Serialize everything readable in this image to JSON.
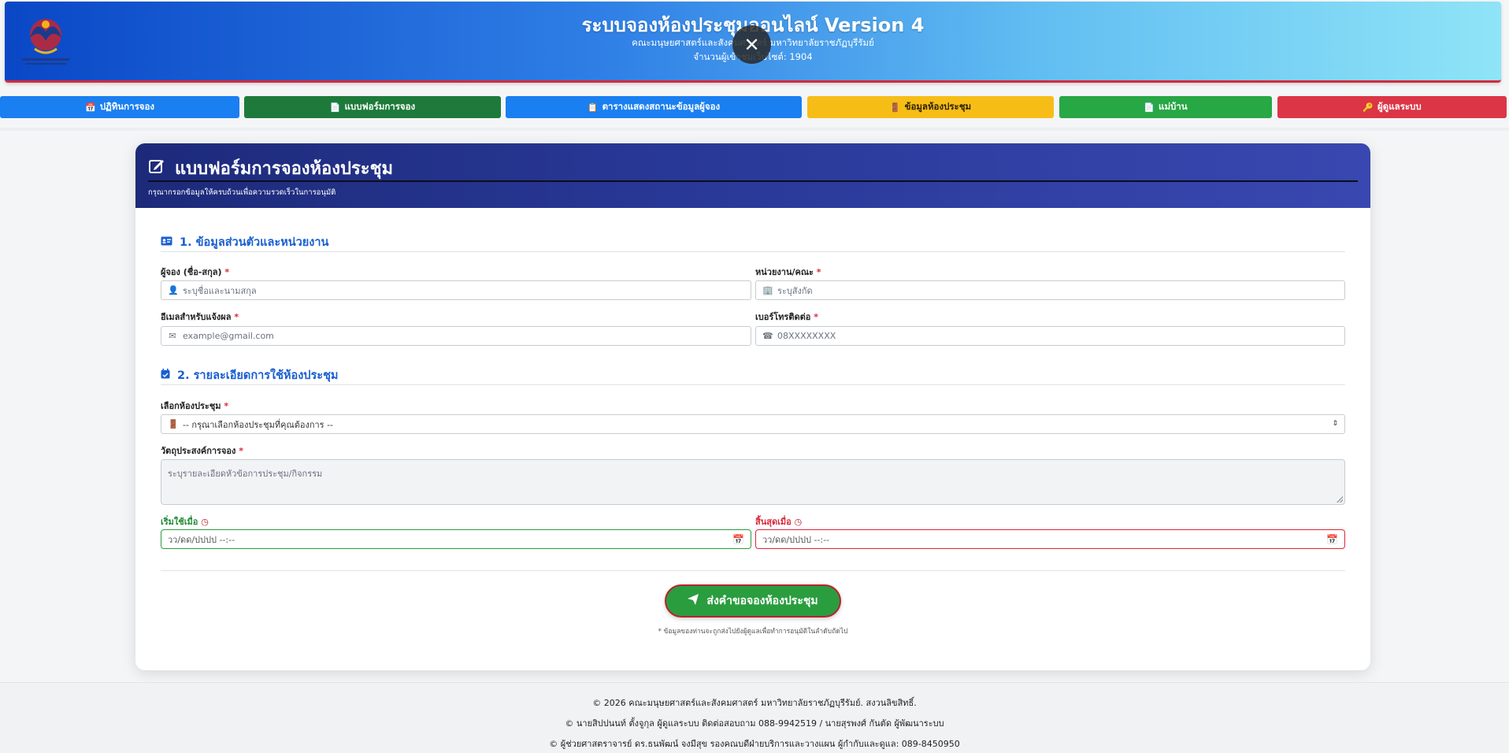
{
  "header": {
    "title": "ระบบจองห้องประชุมออนไลน์ Version 4",
    "subtitle": "คณะมนุษยศาสตร์และสังคมศาสตร์ มหาวิทยาลัยราชภัฏบุรีรัมย์",
    "visits": "จำนวนผู้เข้าชมเว็บไซต์: 1904",
    "logo_caption": "คณะมนุษยศาสตร์และสังคมศาสตร์"
  },
  "nav": [
    {
      "label": "ปฏิทินการจอง",
      "icon": "calendar-icon",
      "color": "#1a7ff0"
    },
    {
      "label": "แบบฟอร์มการจอง",
      "icon": "document-icon",
      "color": "#1e7a3a"
    },
    {
      "label": "ตารางแสดงสถานะข้อมูลผู้จอง",
      "icon": "clipboard-icon",
      "color": "#1a7ff0"
    },
    {
      "label": "ข้อมูลห้องประชุม",
      "icon": "door-icon",
      "color": "#f7bd17"
    },
    {
      "label": "แม่บ้าน",
      "icon": "document-icon",
      "color": "#28a745"
    },
    {
      "label": "ผู้ดูแลระบบ",
      "icon": "key-icon",
      "color": "#dc3545"
    }
  ],
  "form": {
    "title": "แบบฟอร์มการจองห้องประชุม",
    "note": "กรุณากรอกข้อมูลให้ครบถ้วนเพื่อความรวดเร็วในการอนุมัติ",
    "section1": "1. ข้อมูลส่วนตัวและหน่วยงาน",
    "section2": "2. รายละเอียดการใช้ห้องประชุม",
    "fields": {
      "name": {
        "label": "ผู้จอง (ชื่อ-สกุล)",
        "placeholder": "ระบุชื่อและนามสกุล"
      },
      "dept": {
        "label": "หน่วยงาน/คณะ",
        "placeholder": "ระบุสังกัด"
      },
      "email": {
        "label": "อีเมลสำหรับแจ้งผล",
        "placeholder": "example@gmail.com"
      },
      "phone": {
        "label": "เบอร์โทรติดต่อ",
        "placeholder": "08XXXXXXXX"
      },
      "room": {
        "label": "เลือกห้องประชุม",
        "value": "-- กรุณาเลือกห้องประชุมที่คุณต้องการ --"
      },
      "purpose": {
        "label": "วัตถุประสงค์การจอง",
        "placeholder": "ระบุรายละเอียดหัวข้อการประชุม/กิจกรรม"
      },
      "start": {
        "label": "เริ่มใช้เมื่อ",
        "value": "วว/ดด/ปปปป --:--"
      },
      "end": {
        "label": "สิ้นสุดเมื่อ",
        "value": "วว/ดด/ปปปป --:--"
      }
    },
    "required_mark": "*",
    "submit_label": "ส่งคำขอจองห้องประชุม",
    "submit_note": "* ข้อมูลของท่านจะถูกส่งไปยังผู้ดูแลเพื่อทำการอนุมัติในลำดับถัดไป"
  },
  "footer": {
    "line1": "© 2026 คณะมนุษยศาสตร์และสังคมศาสตร์ มหาวิทยาลัยราชภัฏบุรีรัมย์. สงวนลิขสิทธิ์.",
    "line2": "© นายสิปปนนท์ ตั้งจูกุล ผู้ดูแลระบบ ติดต่อสอบถาม 088-9942519 / นายสุรพงศ์ กันตัด ผู้พัฒนาระบบ",
    "line3": "© ผู้ช่วยศาสตราจารย์ ดร.ธนพัฒน์ จงมีสุข รองคณบดีฝ่ายบริการและวางแผน ผู้กำกับและดูแล: 089-8450950"
  }
}
